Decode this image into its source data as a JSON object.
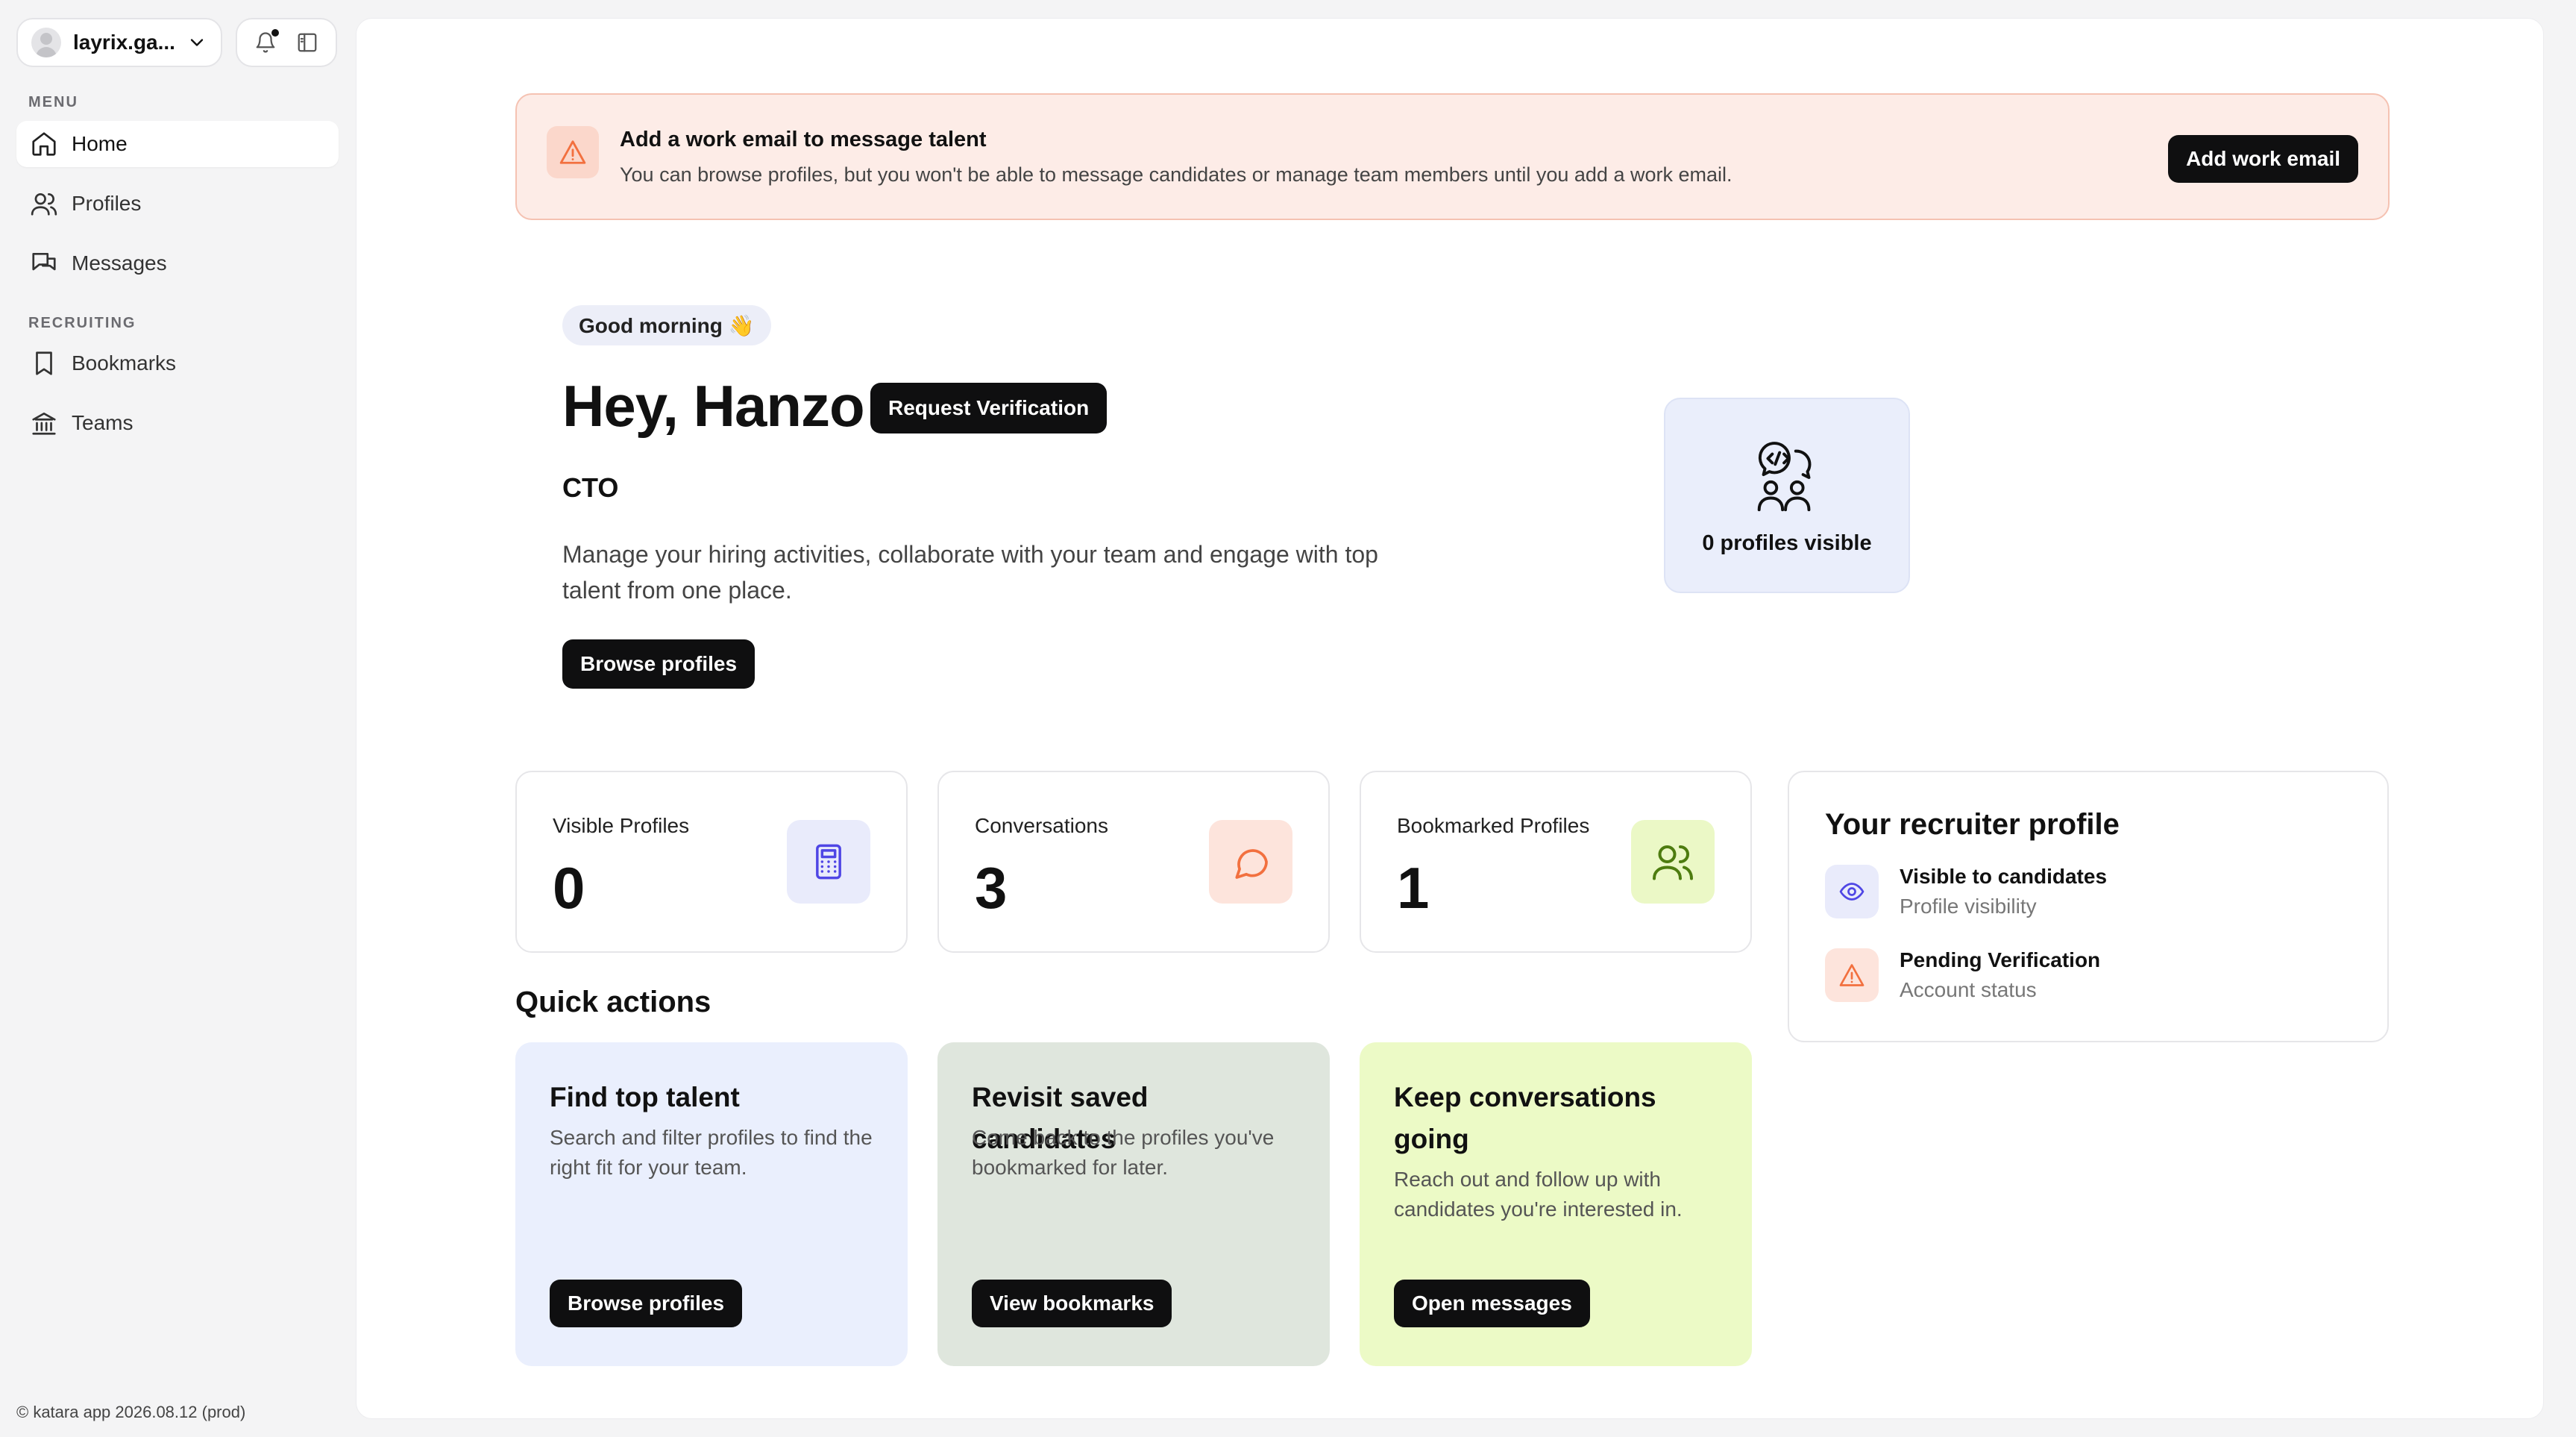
{
  "sidebar": {
    "account_name": "layrix.ga...",
    "menu_label": "MENU",
    "recruiting_label": "RECRUITING",
    "items": [
      {
        "label": "Home",
        "icon": "home-icon",
        "active": true
      },
      {
        "label": "Profiles",
        "icon": "users-icon"
      },
      {
        "label": "Messages",
        "icon": "messages-icon"
      },
      {
        "label": "Bookmarks",
        "icon": "bookmark-icon"
      },
      {
        "label": "Teams",
        "icon": "building-icon"
      }
    ],
    "footer": "© katara app 2026.08.12 (prod)"
  },
  "banner": {
    "title": "Add a work email to message talent",
    "text": "You can browse profiles, but you won't be able to message candidates or manage team members until you add a work email.",
    "button": "Add work email"
  },
  "hero": {
    "greeting": "Good morning 👋",
    "headline": "Hey, Hanzo",
    "verify_button": "Request Verification",
    "role": "CTO",
    "intro": "Manage your hiring activities, collaborate with your team and engage with top talent from one place.",
    "browse_button": "Browse profiles",
    "visible_label": "0 profiles visible"
  },
  "stats": [
    {
      "label": "Visible Profiles",
      "value": "0",
      "icon": "calculator-icon",
      "bg": "#e9ebfb",
      "fg": "#4f46e5"
    },
    {
      "label": "Conversations",
      "value": "3",
      "icon": "chat-icon",
      "bg": "#fde4dc",
      "fg": "#f2703f"
    },
    {
      "label": "Bookmarked Profiles",
      "value": "1",
      "icon": "people-icon",
      "bg": "#ebf8c6",
      "fg": "#4d7c0f"
    }
  ],
  "recruiter": {
    "title": "Your recruiter profile",
    "rows": [
      {
        "title": "Visible to candidates",
        "sub": "Profile visibility"
      },
      {
        "title": "Pending Verification",
        "sub": "Account status"
      }
    ]
  },
  "quick_actions": {
    "title": "Quick actions",
    "cards": [
      {
        "title": "Find top talent",
        "text": "Search and filter profiles to find the right fit for your team.",
        "button": "Browse profiles",
        "bg": "#eaeffd"
      },
      {
        "title": "Revisit saved candidates",
        "text": "Come back to the profiles you've bookmarked for later.",
        "button": "View bookmarks",
        "bg": "#dfe6dd"
      },
      {
        "title": "Keep conversations going",
        "text": "Reach out and follow up with candidates you're interested in.",
        "button": "Open messages",
        "bg": "#ecfac6"
      }
    ]
  }
}
